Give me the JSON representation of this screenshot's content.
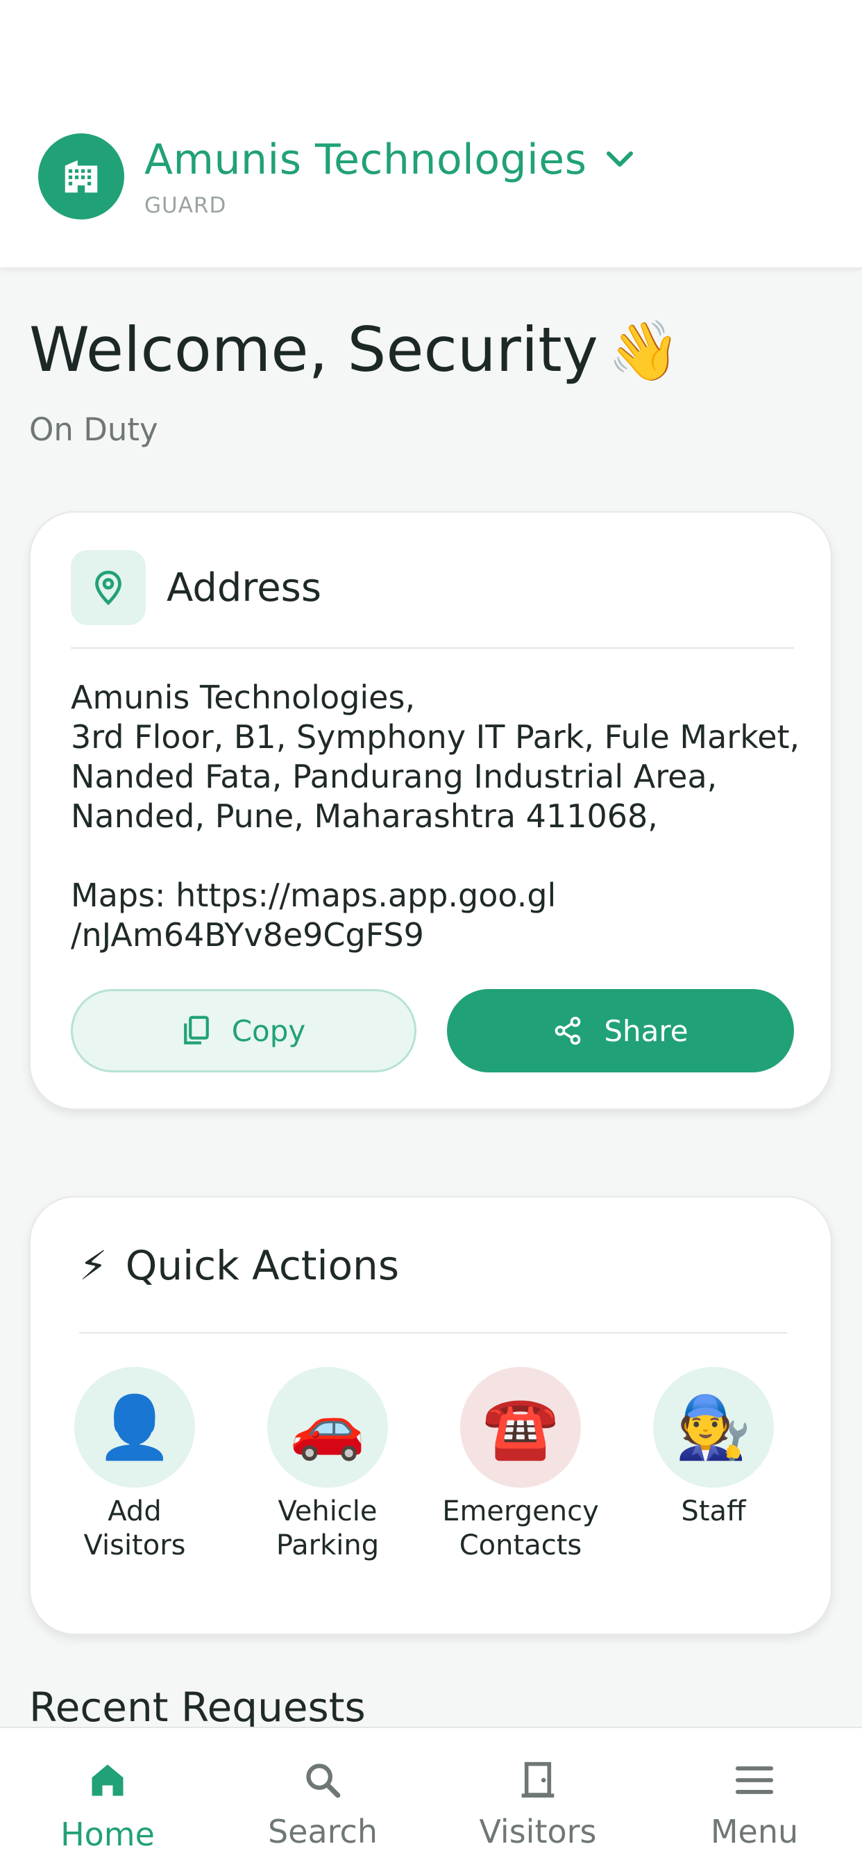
{
  "colors": {
    "accent": "#21a178",
    "accent_light": "#e3f3ee",
    "danger_light": "#f5e3e3",
    "text_primary": "#1f2a28",
    "text_secondary": "#6e7775"
  },
  "header": {
    "org_icon": "building-icon",
    "org_name": "Amunis Technologies",
    "dropdown_icon": "chevron-down-icon",
    "role": "GUARD"
  },
  "welcome": {
    "greeting": "Welcome, Security",
    "emoji": "👋",
    "status": "On Duty"
  },
  "address_card": {
    "icon": "location-pin-icon",
    "title": "Address",
    "text": "Amunis Technologies,\n3rd Floor, B1, Symphony IT Park, Fule Market,\nNanded Fata, Pandurang Industrial Area,\nNanded, Pune, Maharashtra 411068,\n\nMaps: https://maps.app.goo.gl\n/nJAm64BYv8e9CgFS9",
    "copy_label": "Copy",
    "copy_icon": "copy-icon",
    "share_label": "Share",
    "share_icon": "share-icon"
  },
  "quick_actions": {
    "emoji": "⚡",
    "title": "Quick Actions",
    "items": [
      {
        "label": "Add\nVisitors",
        "emoji": "👤",
        "icon": "person-icon"
      },
      {
        "label": "Vehicle\nParking",
        "emoji": "🚗",
        "icon": "parking-icon"
      },
      {
        "label": "Emergency\nContacts",
        "emoji": "☎️",
        "icon": "telephone-icon"
      },
      {
        "label": "Staff",
        "emoji": "🧑‍🔧",
        "icon": "mechanic-icon"
      }
    ]
  },
  "recent_requests": {
    "title": "Recent Requests"
  },
  "bottom_nav": {
    "items": [
      {
        "label": "Home",
        "icon": "home-icon",
        "active": true
      },
      {
        "label": "Search",
        "icon": "search-icon",
        "active": false
      },
      {
        "label": "Visitors",
        "icon": "door-icon",
        "active": false
      },
      {
        "label": "Menu",
        "icon": "menu-icon",
        "active": false
      }
    ]
  }
}
